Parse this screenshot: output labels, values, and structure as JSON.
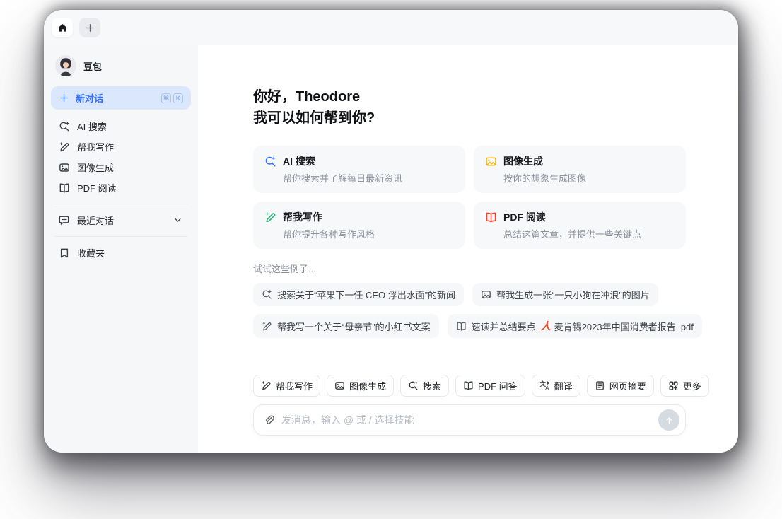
{
  "app": {
    "accent_color": "#3370ff",
    "card_icon_colors": {
      "search": "#3370ff",
      "image": "#f0b11c",
      "write": "#17b26a",
      "book": "#f0442c"
    }
  },
  "tabbar": {
    "tabs": [
      {
        "icon": "home-icon"
      },
      {
        "icon": "plus-icon"
      }
    ]
  },
  "sidebar": {
    "profile_name": "豆包",
    "new_chat": {
      "label": "新对话",
      "shortcut_keys": [
        "⌘",
        "K"
      ]
    },
    "items": [
      {
        "icon": "ai-search-icon",
        "label": "AI 搜索"
      },
      {
        "icon": "write-icon",
        "label": "帮我写作"
      },
      {
        "icon": "image-icon",
        "label": "图像生成"
      },
      {
        "icon": "book-icon",
        "label": "PDF 阅读"
      }
    ],
    "recent": {
      "icon": "chat-icon",
      "label": "最近对话"
    },
    "favorites": {
      "icon": "bookmark-icon",
      "label": "收藏夹"
    }
  },
  "main": {
    "greeting_line1": "你好，Theodore",
    "greeting_line2": "我可以如何帮到你?",
    "cards": [
      {
        "icon": "search-icon",
        "title": "AI 搜索",
        "desc": "帮你搜索并了解每日最新资讯"
      },
      {
        "icon": "image-icon",
        "title": "图像生成",
        "desc": "按你的想象生成图像"
      },
      {
        "icon": "write-icon",
        "title": "帮我写作",
        "desc": "帮你提升各种写作风格"
      },
      {
        "icon": "book-icon",
        "title": "PDF 阅读",
        "desc": "总结这篇文章，并提供一些关键点"
      }
    ],
    "examples_label": "试试这些例子...",
    "examples": [
      {
        "icon": "search-icon",
        "text": "搜索关于“苹果下一任 CEO 浮出水面”的新闻"
      },
      {
        "icon": "image-icon",
        "text": "帮我生成一张“一只小狗在冲浪”的图片"
      },
      {
        "icon": "write-icon",
        "text": "帮我写一个关于“母亲节”的小红书文案"
      },
      {
        "icon": "book-icon",
        "text": "速读并总结要点",
        "attachment": {
          "icon": "pdf-file-icon",
          "name": "麦肯锡2023年中国消费者报告. pdf"
        }
      }
    ]
  },
  "composer": {
    "skills": [
      {
        "icon": "write-icon",
        "label": "帮我写作"
      },
      {
        "icon": "image-icon",
        "label": "图像生成"
      },
      {
        "icon": "search-icon",
        "label": "搜索"
      },
      {
        "icon": "book-icon",
        "label": "PDF 问答"
      },
      {
        "icon": "translate-icon",
        "label": "翻译"
      },
      {
        "icon": "page-icon",
        "label": "网页摘要"
      },
      {
        "icon": "grid-more-icon",
        "label": "更多"
      }
    ],
    "input_placeholder": "发消息，输入 @ 或 / 选择技能"
  }
}
